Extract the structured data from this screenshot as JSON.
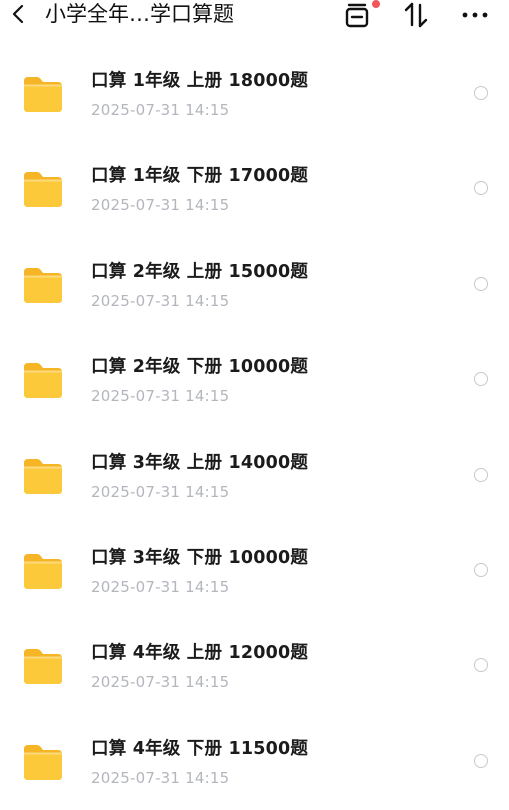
{
  "header": {
    "title": "小学全年…学口算题",
    "back_icon": "chevron-left-icon",
    "actions": [
      {
        "icon": "recycle-bin-icon",
        "has_badge": true
      },
      {
        "icon": "sort-icon"
      },
      {
        "icon": "more-icon"
      }
    ]
  },
  "colors": {
    "folder": "#fcc93a",
    "badge": "#f2555a",
    "date_text": "#b4b6bd"
  },
  "files": [
    {
      "name": "口算 1年级 上册  18000题",
      "date": "2025-07-31 14:15",
      "icon": "folder-icon"
    },
    {
      "name": "口算 1年级 下册  17000题",
      "date": "2025-07-31 14:15",
      "icon": "folder-icon"
    },
    {
      "name": "口算 2年级 上册  15000题",
      "date": "2025-07-31 14:15",
      "icon": "folder-icon"
    },
    {
      "name": "口算 2年级 下册  10000题",
      "date": "2025-07-31 14:15",
      "icon": "folder-icon"
    },
    {
      "name": "口算 3年级 上册 14000题",
      "date": "2025-07-31 14:15",
      "icon": "folder-icon"
    },
    {
      "name": "口算 3年级 下册 10000题",
      "date": "2025-07-31 14:15",
      "icon": "folder-icon"
    },
    {
      "name": "口算 4年级 上册 12000题",
      "date": "2025-07-31 14:15",
      "icon": "folder-icon"
    },
    {
      "name": "口算 4年级 下册 11500题",
      "date": "2025-07-31 14:15",
      "icon": "folder-icon"
    }
  ]
}
